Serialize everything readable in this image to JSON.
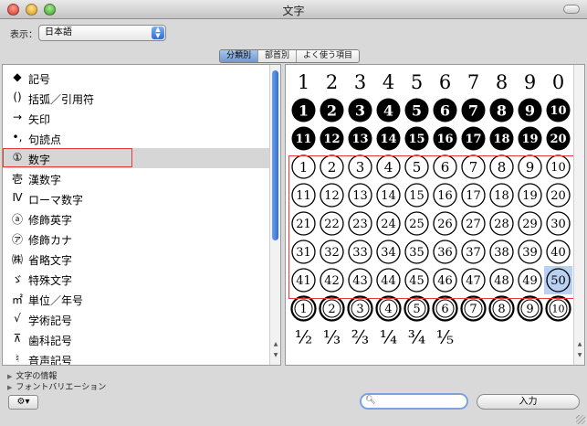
{
  "window": {
    "title": "文字"
  },
  "toolbar": {
    "view_label": "表示：",
    "view_value": "日本語"
  },
  "tabs": [
    {
      "label": "分類別",
      "selected": true
    },
    {
      "label": "部首別",
      "selected": false
    },
    {
      "label": "よく使う項目",
      "selected": false
    }
  ],
  "categories": [
    {
      "icon": "◆",
      "label": "記号",
      "selected": false
    },
    {
      "icon": "()",
      "label": "括弧／引用符",
      "selected": false
    },
    {
      "icon": "→",
      "label": "矢印",
      "selected": false
    },
    {
      "icon": "•,",
      "label": "句読点",
      "selected": false
    },
    {
      "icon": "①",
      "label": "数字",
      "selected": true
    },
    {
      "icon": "壱",
      "label": "漢数字",
      "selected": false
    },
    {
      "icon": "Ⅳ",
      "label": "ローマ数字",
      "selected": false
    },
    {
      "icon": "ⓐ",
      "label": "修飾英字",
      "selected": false
    },
    {
      "icon": "㋐",
      "label": "修飾カナ",
      "selected": false
    },
    {
      "icon": "㈱",
      "label": "省略文字",
      "selected": false
    },
    {
      "icon": "ゞ",
      "label": "特殊文字",
      "selected": false
    },
    {
      "icon": "㎡",
      "label": "単位／年号",
      "selected": false
    },
    {
      "icon": "√",
      "label": "学術記号",
      "selected": false
    },
    {
      "icon": "⊼",
      "label": "歯科記号",
      "selected": false
    },
    {
      "icon": "♮",
      "label": "音声記号",
      "selected": false
    }
  ],
  "grid": {
    "rows": [
      {
        "style": "plain",
        "chars": [
          "1",
          "2",
          "3",
          "4",
          "5",
          "6",
          "7",
          "8",
          "9",
          "0"
        ]
      },
      {
        "style": "black",
        "chars": [
          "1",
          "2",
          "3",
          "4",
          "5",
          "6",
          "7",
          "8",
          "9",
          "10"
        ]
      },
      {
        "style": "black",
        "chars": [
          "11",
          "12",
          "13",
          "14",
          "15",
          "16",
          "17",
          "18",
          "19",
          "20"
        ]
      },
      {
        "style": "circled",
        "chars": [
          "1",
          "2",
          "3",
          "4",
          "5",
          "6",
          "7",
          "8",
          "9",
          "10"
        ]
      },
      {
        "style": "circled",
        "chars": [
          "11",
          "12",
          "13",
          "14",
          "15",
          "16",
          "17",
          "18",
          "19",
          "20"
        ]
      },
      {
        "style": "circled",
        "chars": [
          "21",
          "22",
          "23",
          "24",
          "25",
          "26",
          "27",
          "28",
          "29",
          "30"
        ]
      },
      {
        "style": "circled",
        "chars": [
          "31",
          "32",
          "33",
          "34",
          "35",
          "36",
          "37",
          "38",
          "39",
          "40"
        ]
      },
      {
        "style": "circled",
        "chars": [
          "41",
          "42",
          "43",
          "44",
          "45",
          "46",
          "47",
          "48",
          "49",
          "50"
        ]
      },
      {
        "style": "double",
        "chars": [
          "1",
          "2",
          "3",
          "4",
          "5",
          "6",
          "7",
          "8",
          "9",
          "10"
        ]
      },
      {
        "style": "fraction",
        "chars": [
          "½",
          "⅓",
          "⅔",
          "¼",
          "¾",
          "⅕"
        ]
      }
    ],
    "selected": "50"
  },
  "footer": {
    "char_info": "文字の情報",
    "font_variation": "フォントバリエーション",
    "insert_label": "入力",
    "search_value": ""
  }
}
